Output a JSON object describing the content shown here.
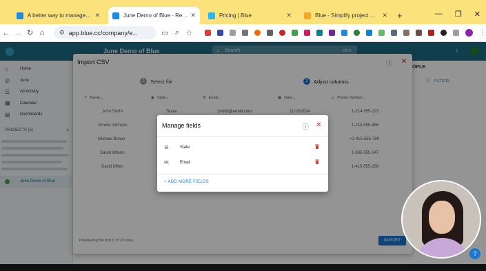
{
  "browser": {
    "tabs": [
      {
        "title": "A better way to manage projec",
        "color": "#1e88e5",
        "active": false
      },
      {
        "title": "June Demo of Blue - Records",
        "color": "#1e88e5",
        "active": true
      },
      {
        "title": "Pricing | Blue",
        "color": "#1e88e5",
        "active": false
      },
      {
        "title": "Blue - Simplify project manage",
        "color": "#f9a825",
        "active": false
      }
    ],
    "tab_close": "✕",
    "new_tab": "+",
    "url": "app.blue.cc/company/e..."
  },
  "app": {
    "project_title": "June Demo of Blue",
    "search_placeholder": "Search",
    "search_shortcut": "Ctrl K",
    "right_header": "OPLE",
    "filters": "FILTERS",
    "sidebar": {
      "items": [
        {
          "label": "Home",
          "icon": "home-icon"
        },
        {
          "label": "June",
          "icon": "check-circle-icon"
        },
        {
          "label": "All Activity",
          "icon": "activity-icon"
        },
        {
          "label": "Calendar",
          "icon": "calendar-icon"
        },
        {
          "label": "Dashboards",
          "icon": "dashboard-icon"
        }
      ],
      "projects_header": "PROJECTS (5)",
      "selected_project": "June Demo of Blue"
    }
  },
  "import_modal": {
    "title": "Import CSV",
    "steps": [
      {
        "num": "1",
        "label": "Select file"
      },
      {
        "num": "2",
        "label": "Adjust columns"
      }
    ],
    "columns": [
      "Name",
      "State",
      "Email",
      "Date",
      "Phone Number"
    ],
    "rows": [
      {
        "name": "John Smith",
        "state": "Texas",
        "email": "jsmith@email.com",
        "date": "11/15/2024",
        "phone": "1-214-555-123"
      },
      {
        "name": "Emma Johnson",
        "state": "",
        "email": "",
        "date": "",
        "phone": "1-214-555-456"
      },
      {
        "name": "Michael Brown",
        "state": "",
        "email": "",
        "date": "",
        "phone": "+1-415-555-789"
      },
      {
        "name": "Sarah Wilson",
        "state": "",
        "email": "",
        "date": "",
        "phone": "1-305-555-147"
      },
      {
        "name": "David Miller",
        "state": "",
        "email": "",
        "date": "",
        "phone": "1-415-555-258"
      }
    ],
    "preview_note": "Previewing the first 5 of 10 rows",
    "import_button": "IMPORT"
  },
  "manage_fields": {
    "title": "Manage fields",
    "fields": [
      {
        "label": "State",
        "icon": "dropdown-circle-icon"
      },
      {
        "label": "Email",
        "icon": "envelope-icon"
      }
    ],
    "add_more": "+ ADD MORE FIELDS"
  },
  "colors": {
    "accent": "#1976d2",
    "danger": "#d32f2f",
    "app_header": "#1d6b86",
    "tab_bar": "#fbe27a"
  }
}
